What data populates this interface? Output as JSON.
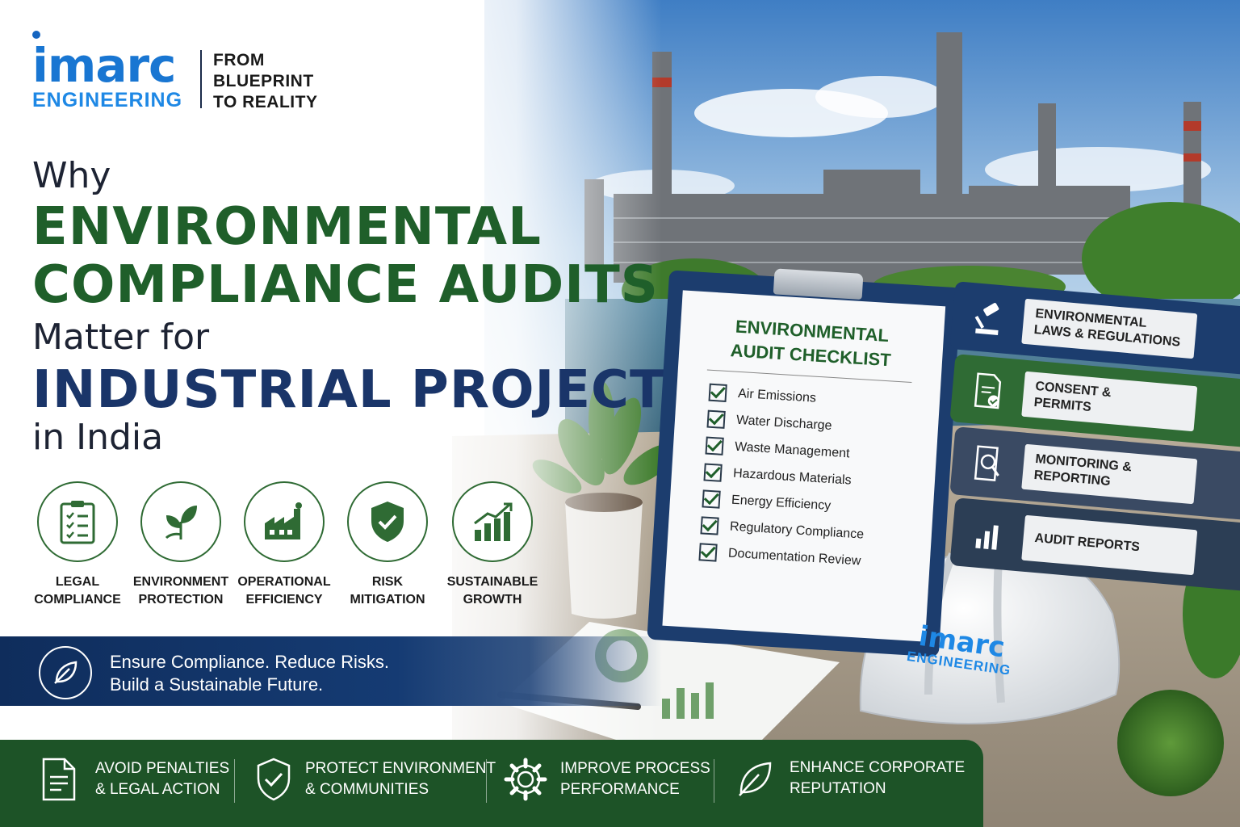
{
  "brand": {
    "logo_word": "imarc",
    "logo_sub": "ENGINEERING",
    "tagline": [
      "FROM",
      "BLUEPRINT",
      "TO REALITY"
    ]
  },
  "headline": {
    "line1": "Why",
    "line2": "ENVIRONMENTAL",
    "line3": "COMPLIANCE AUDITS",
    "line4": "Matter for",
    "line5": "INDUSTRIAL PROJECTS",
    "line6": "in India"
  },
  "features": [
    {
      "icon": "clipboard-checklist-icon",
      "line1": "LEGAL",
      "line2": "COMPLIANCE"
    },
    {
      "icon": "leaf-sprout-icon",
      "line1": "ENVIRONMENT",
      "line2": "PROTECTION"
    },
    {
      "icon": "factory-icon",
      "line1": "OPERATIONAL",
      "line2": "EFFICIENCY"
    },
    {
      "icon": "shield-check-icon",
      "line1": "RISK",
      "line2": "MITIGATION"
    },
    {
      "icon": "growth-chart-icon",
      "line1": "SUSTAINABLE",
      "line2": "GROWTH"
    }
  ],
  "banner": {
    "icon": "leaf-icon",
    "line1": "Ensure Compliance. Reduce Risks.",
    "line2": "Build a Sustainable Future."
  },
  "checklist": {
    "title_line1": "ENVIRONMENTAL",
    "title_line2": "AUDIT CHECKLIST",
    "items": [
      "Air Emissions",
      "Water Discharge",
      "Waste Management",
      "Hazardous Materials",
      "Energy Efficiency",
      "Regulatory Compliance",
      "Documentation Review"
    ]
  },
  "binders": [
    {
      "icon": "gavel-icon",
      "line1": "ENVIRONMENTAL",
      "line2": "LAWS & REGULATIONS",
      "color": "#1c3d6e"
    },
    {
      "icon": "document-check-icon",
      "line1": "CONSENT &",
      "line2": "PERMITS",
      "color": "#2f6b34"
    },
    {
      "icon": "magnifier-report-icon",
      "line1": "MONITORING &",
      "line2": "REPORTING",
      "color": "#3a4a63"
    },
    {
      "icon": "bar-chart-icon",
      "line1": "AUDIT REPORTS",
      "line2": "",
      "color": "#2c3e55"
    }
  ],
  "helmet": {
    "logo_word": "imarc",
    "logo_sub": "ENGINEERING"
  },
  "benefits": [
    {
      "icon": "document-icon",
      "line1": "AVOID PENALTIES",
      "line2": "& LEGAL ACTION"
    },
    {
      "icon": "shield-check-icon",
      "line1": "PROTECT ENVIRONMENT",
      "line2": "& COMMUNITIES"
    },
    {
      "icon": "gear-icon",
      "line1": "IMPROVE PROCESS",
      "line2": "PERFORMANCE"
    },
    {
      "icon": "leaf-icon",
      "line1": "ENHANCE CORPORATE",
      "line2": "REPUTATION"
    }
  ],
  "colors": {
    "brand_blue": "#1976d2",
    "headline_green": "#1f5f2a",
    "headline_navy": "#1a3569",
    "banner_navy": "#153b73",
    "footer_green": "#1d5327"
  }
}
